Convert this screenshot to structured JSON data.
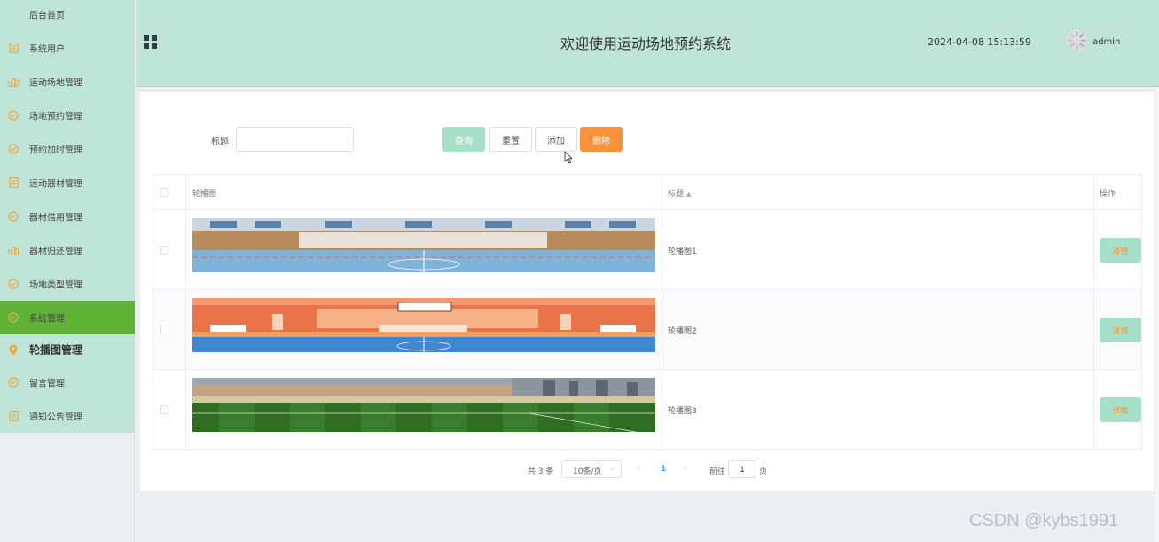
{
  "sidebar": {
    "items": [
      {
        "label": "后台首页",
        "icon": "none"
      },
      {
        "label": "系统用户",
        "icon": "doc-icon"
      },
      {
        "label": "运动场地管理",
        "icon": "bar-chart-icon"
      },
      {
        "label": "场地预约管理",
        "icon": "chat-icon"
      },
      {
        "label": "预约加时管理",
        "icon": "check-circle-icon"
      },
      {
        "label": "运动器材管理",
        "icon": "doc-icon"
      },
      {
        "label": "器材借用管理",
        "icon": "chat-icon"
      },
      {
        "label": "器材归还管理",
        "icon": "bar-chart-icon"
      },
      {
        "label": "场地类型管理",
        "icon": "check-circle-icon"
      },
      {
        "label": "系统管理",
        "icon": "chat-icon"
      },
      {
        "label": "轮播图管理",
        "icon": "location-pin-icon"
      },
      {
        "label": "留言管理",
        "icon": "check-circle-icon"
      },
      {
        "label": "通知公告管理",
        "icon": "doc-icon"
      }
    ],
    "icon_color": "#f0a53c",
    "active_color": "#5fb236"
  },
  "header": {
    "title": "欢迎使用运动场地预约系统",
    "datetime": "2024-04-08 15:13:59",
    "username": "admin"
  },
  "search": {
    "label": "标题",
    "value": "",
    "placeholder": ""
  },
  "toolbar": {
    "query_label": "查询",
    "reset_label": "重置",
    "add_label": "添加",
    "delete_label": "删除"
  },
  "table": {
    "headers": {
      "image": "轮播图",
      "title": "标题",
      "actions": "操作"
    },
    "rows": [
      {
        "title": "轮播图1",
        "action_label": "详情",
        "image": "indoor-court-photo"
      },
      {
        "title": "轮播图2",
        "action_label": "详情",
        "image": "orange-indoor-court-photo"
      },
      {
        "title": "轮播图3",
        "action_label": "详情",
        "image": "outdoor-field-photo"
      }
    ]
  },
  "pagination": {
    "total_text": "共 3 条",
    "page_size": "10条/页",
    "current_page": "1",
    "goto_label": "前往",
    "goto_value": "1",
    "page_suffix": "页"
  },
  "watermark": "CSDN @kybs1991",
  "colors": {
    "header_bg": "#bde4d6",
    "primary_btn": "#a6e0c8",
    "danger_btn": "#f7923b"
  }
}
